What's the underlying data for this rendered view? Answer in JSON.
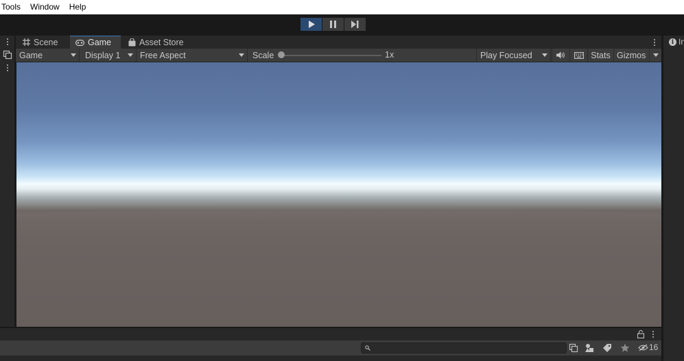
{
  "menu": {
    "items": [
      "Tools",
      "Window",
      "Help"
    ]
  },
  "play_controls": {
    "play": "play-icon",
    "pause": "pause-icon",
    "step": "step-icon",
    "active_color": "#2a4a72"
  },
  "tabs": [
    {
      "label": "Scene",
      "icon": "grid-icon"
    },
    {
      "label": "Game",
      "icon": "gamepad-icon",
      "active": true
    },
    {
      "label": "Asset Store",
      "icon": "bag-icon"
    }
  ],
  "game_toolbar": {
    "display_mode": "Game",
    "display": "Display 1",
    "aspect": "Free Aspect",
    "scale_label": "Scale",
    "scale_value": "1x",
    "scale_fraction": 0.0,
    "play_mode": "Play Focused",
    "stats": "Stats",
    "gizmos": "Gizmos"
  },
  "right_panel": {
    "label": "In"
  },
  "bottom_panel": {
    "search_value": "",
    "hidden_count": "16"
  },
  "colors": {
    "sky_top": "#56709a",
    "horizon": "#f2fbff",
    "ground": "#6b6360",
    "panel": "#282828",
    "toolbar": "#3c3c3c"
  }
}
